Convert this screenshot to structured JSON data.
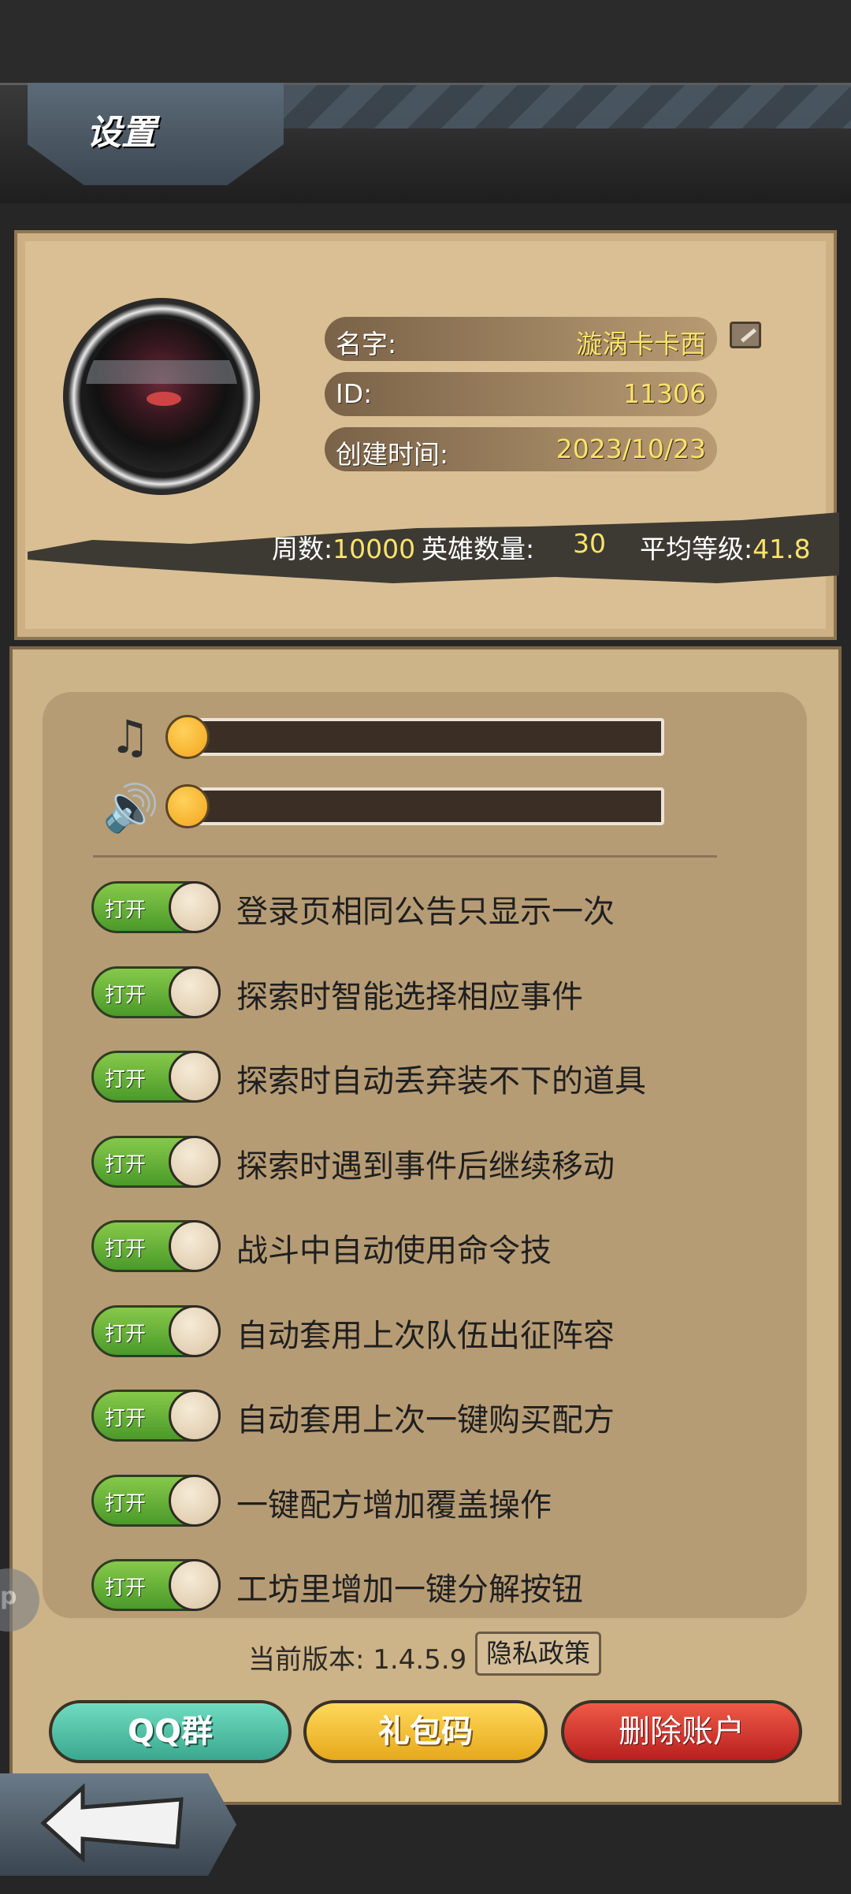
{
  "header": {
    "title": "设置"
  },
  "profile": {
    "name_label": "名字:",
    "name_value": "漩涡卡卡西",
    "id_label": "ID:",
    "id_value": "11306",
    "created_label": "创建时间:",
    "created_value": "2023/10/23",
    "stats": {
      "weeks_label": "周数:",
      "weeks_value": "10000",
      "heroes_label": "英雄数量:",
      "heroes_value": "30",
      "avg_label": "平均等级:",
      "avg_value": "41.8"
    }
  },
  "audio": {
    "music_icon": "music-note-icon",
    "sound_icon": "speaker-icon",
    "music_level": 0,
    "sound_level": 0
  },
  "options": [
    {
      "toggle_label": "打开",
      "text": "登录页相同公告只显示一次",
      "on": true
    },
    {
      "toggle_label": "打开",
      "text": "探索时智能选择相应事件",
      "on": true
    },
    {
      "toggle_label": "打开",
      "text": "探索时自动丢弃装不下的道具",
      "on": true
    },
    {
      "toggle_label": "打开",
      "text": "探索时遇到事件后继续移动",
      "on": true
    },
    {
      "toggle_label": "打开",
      "text": "战斗中自动使用命令技",
      "on": true
    },
    {
      "toggle_label": "打开",
      "text": "自动套用上次队伍出征阵容",
      "on": true
    },
    {
      "toggle_label": "打开",
      "text": "自动套用上次一键购买配方",
      "on": true
    },
    {
      "toggle_label": "打开",
      "text": "一键配方增加覆盖操作",
      "on": true
    },
    {
      "toggle_label": "打开",
      "text": "工坊里增加一键分解按钮",
      "on": true
    }
  ],
  "footer": {
    "version_text": "当前版本: 1.4.5.9",
    "privacy_label": "隐私政策",
    "qq_label": "QQ群",
    "gift_label": "礼包码",
    "delete_label": "删除账户"
  },
  "side_bubble_text": "p",
  "colors": {
    "toggle_on": "#5fb33a",
    "accent_yellow": "#f9e36a",
    "panel": "#ccb388"
  }
}
